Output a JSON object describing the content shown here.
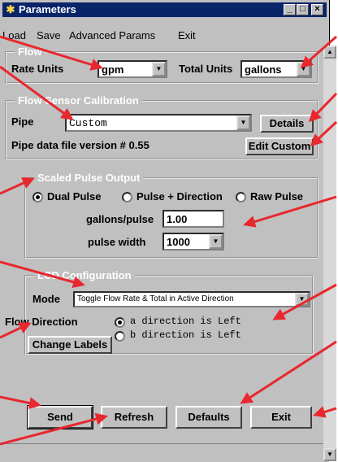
{
  "window": {
    "title": "Parameters"
  },
  "menu": [
    "Load",
    "Save",
    "Advanced Params",
    "Exit"
  ],
  "flow": {
    "legend": "Flow",
    "rate_units_label": "Rate Units",
    "rate_units_value": "gpm",
    "total_units_label": "Total Units",
    "total_units_value": "gallons"
  },
  "calibration": {
    "legend": "Flow Sensor Calibration",
    "pipe_label": "Pipe",
    "pipe_value": "Custom",
    "details_label": "Details",
    "version_text": "Pipe data file version # 0.55",
    "edit_custom_label": "Edit Custom"
  },
  "pulse": {
    "legend": "Scaled Pulse Output",
    "options": [
      "Dual Pulse",
      "Pulse + Direction",
      "Raw Pulse"
    ],
    "selected": 0,
    "gallons_per_pulse_label": "gallons/pulse",
    "gallons_per_pulse_value": "1.00",
    "pulse_width_label": "pulse width",
    "pulse_width_value": "1000"
  },
  "lcd": {
    "legend": "LCD Configuration",
    "mode_label": "Mode",
    "mode_value": "Toggle Flow Rate & Total in Active Direction",
    "flow_direction_label": "Flow Direction",
    "direction_options": [
      "a direction is Left",
      "b direction is Left"
    ],
    "selected": 0,
    "change_labels_label": "Change Labels"
  },
  "buttons": {
    "send": "Send",
    "refresh": "Refresh",
    "defaults": "Defaults",
    "exit": "Exit"
  },
  "colors": {
    "titlebar": "#0a246a",
    "panel": "#c0c0c0",
    "annotation_arrow": "#e8272e"
  }
}
